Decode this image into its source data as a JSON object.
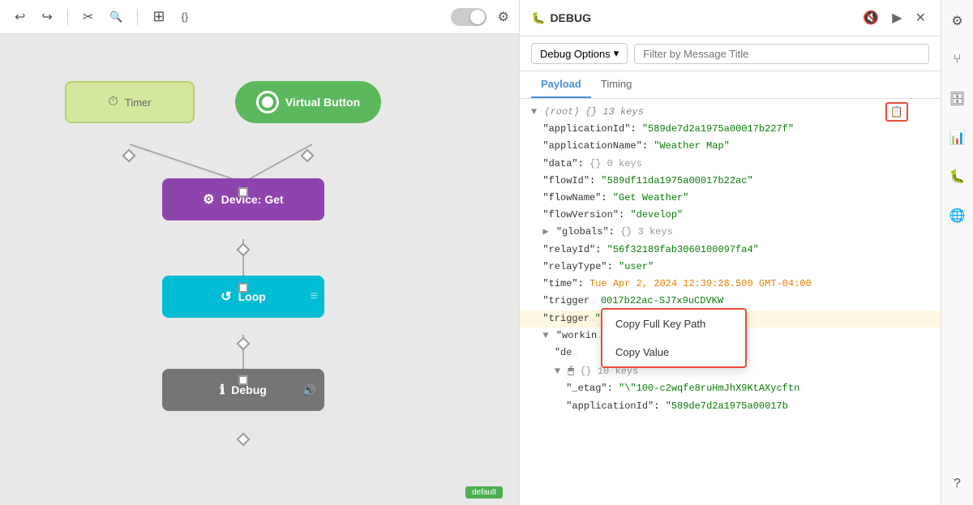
{
  "toolbar": {
    "undo_icon": "↩",
    "redo_icon": "↪",
    "cut_icon": "✂",
    "search_icon": "🔍",
    "add_icon": "＋",
    "code_icon": "{}",
    "settings_icon": "⚙"
  },
  "canvas": {
    "nodes": [
      {
        "id": "timer",
        "label": "Timer",
        "icon": "⏱"
      },
      {
        "id": "virtual-button",
        "label": "Virtual Button"
      },
      {
        "id": "device-get",
        "label": "Device: Get",
        "icon": "⚙"
      },
      {
        "id": "loop",
        "label": "Loop",
        "icon": "↺"
      },
      {
        "id": "debug",
        "label": "Debug",
        "icon": "ℹ"
      }
    ],
    "default_badge": "default"
  },
  "debug": {
    "title": "DEBUG",
    "title_icon": "🐛",
    "options_button": "Debug Options",
    "filter_placeholder": "Filter by Message Title",
    "tabs": [
      "Payload",
      "Timing"
    ],
    "active_tab": "Payload",
    "copy_button": "📋",
    "mute_icon": "🔇",
    "play_icon": "▶",
    "close_icon": "✕",
    "help_icon": "?",
    "payload": {
      "root_label": "(root) {} 13 keys",
      "lines": [
        {
          "key": "\"applicationId\"",
          "value": "\"589de7d2a1975a00017b227f\""
        },
        {
          "key": "\"applicationName\"",
          "value": "\"Weather Map\""
        },
        {
          "key": "\"data\"",
          "value": "{} 0 keys"
        },
        {
          "key": "\"flowId\"",
          "value": "\"589df11da1975a00017b22ac\""
        },
        {
          "key": "\"flowName\"",
          "value": "\"Get Weather\""
        },
        {
          "key": "\"flowVersion\"",
          "value": "\"develop\""
        },
        {
          "key": "▶ \"globals\"",
          "value": "{} 3 keys"
        },
        {
          "key": "\"relayId\"",
          "value": "\"56f32189fab3060100097fa4\""
        },
        {
          "key": "\"relayType\"",
          "value": "\"user\""
        },
        {
          "key": "\"time\"",
          "value": "Tue Apr 2, 2024 12:39:28.500 GMT-04:00",
          "type": "date"
        },
        {
          "key": "\"trigger",
          "value": "...0017b22ac-SJ7x9uCDVKW",
          "truncated": true
        },
        {
          "key": "\"trigger",
          "value": "\"",
          "truncated": true,
          "highlight": true
        },
        {
          "key": "▼ \"workin",
          "value": "",
          "truncated": true
        },
        {
          "key": "  \"de",
          "value": "",
          "truncated": true
        },
        {
          "key": "  ▼ 🖱 {} 10 keys",
          "value": ""
        },
        {
          "key": "    \"_etag\"",
          "value": "\"\\\"100-c2wqfe8ruHmJhX9KtAXycftn"
        },
        {
          "key": "    \"applicationId\"",
          "value": "\"589de7d2a1975a00017b"
        }
      ]
    }
  },
  "context_menu": {
    "items": [
      {
        "label": "Copy Full Key Path"
      },
      {
        "label": "Copy Value"
      }
    ]
  }
}
